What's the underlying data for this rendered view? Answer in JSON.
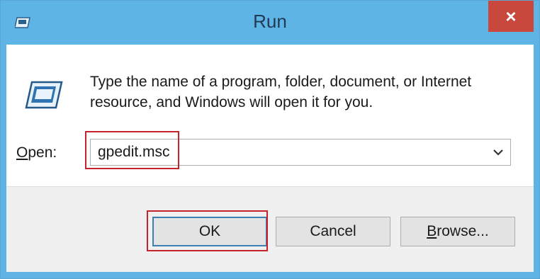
{
  "window": {
    "title": "Run",
    "close_label": "×",
    "colors": {
      "titlebar": "#5fb4e6",
      "close": "#c9483d",
      "highlight": "#c8232c"
    }
  },
  "icons": {
    "title": "run-icon",
    "main": "run-icon",
    "dropdown": "chevron-down-icon"
  },
  "content": {
    "description_line1": "Type the name of a program, folder, document, or Internet",
    "description_line2": "resource, and Windows will open it for you.",
    "open_label_accel": "O",
    "open_label_rest": "pen:",
    "open_value": "gpedit.msc"
  },
  "buttons": {
    "ok": "OK",
    "cancel": "Cancel",
    "browse_accel": "B",
    "browse_rest": "rowse..."
  }
}
